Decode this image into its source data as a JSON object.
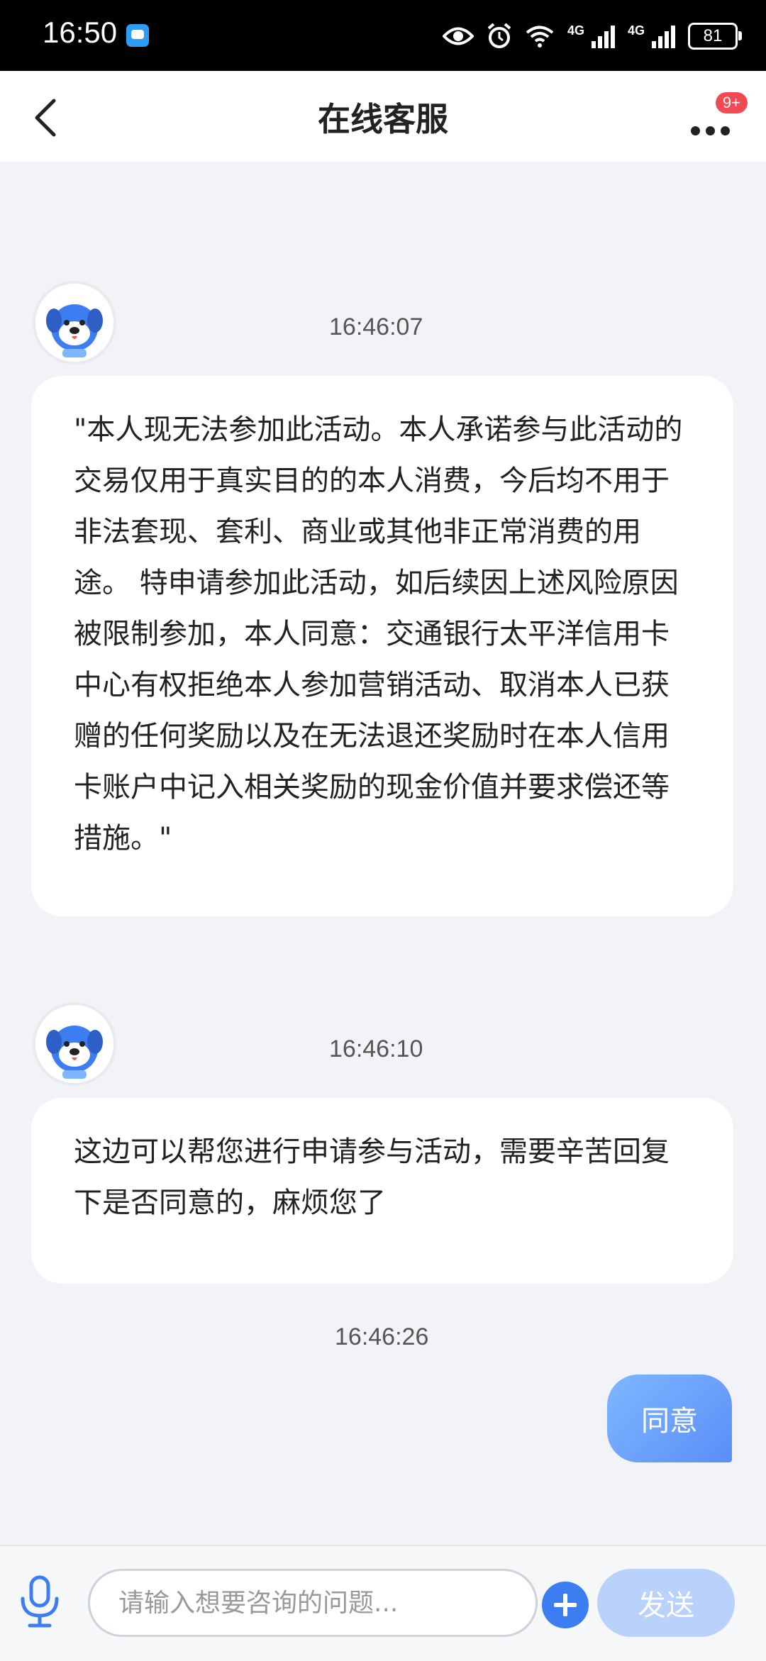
{
  "status_bar": {
    "time": "16:50",
    "network_1": "4G",
    "network_2": "4G",
    "battery": "81"
  },
  "header": {
    "title": "在线客服",
    "badge": "9+"
  },
  "messages": [
    {
      "timestamp": "16:46:07",
      "text": "\"本人现无法参加此活动。本人承诺参与此活动的交易仅用于真实目的的本人消费，今后均不用于非法套现、套利、商业或其他非正常消费的用途。 特申请参加此活动，如后续因上述风险原因被限制参加，本人同意：交通银行太平洋信用卡中心有权拒绝本人参加营销活动、取消本人已获赠的任何奖励以及在无法退还奖励时在本人信用卡账户中记入相关奖励的现金价值并要求偿还等措施。\""
    },
    {
      "timestamp": "16:46:10",
      "text": "这边可以帮您进行申请参与活动，需要辛苦回复下是否同意的，麻烦您了"
    },
    {
      "timestamp": "16:46:26",
      "text": "同意"
    }
  ],
  "input": {
    "placeholder": "请输入想要咨询的问题...",
    "send_label": "发送"
  },
  "colors": {
    "accent": "#3d7df2",
    "badge": "#f24a55",
    "send_disabled": "#b9d2fb",
    "user_bubble": "#6a9ef9",
    "background": "#f1f3f7"
  },
  "icons": {
    "back": "chevron-left-icon",
    "more": "more-dots-icon",
    "mic": "microphone-icon",
    "plus": "plus-icon",
    "avatar": "dog-mascot-avatar"
  }
}
